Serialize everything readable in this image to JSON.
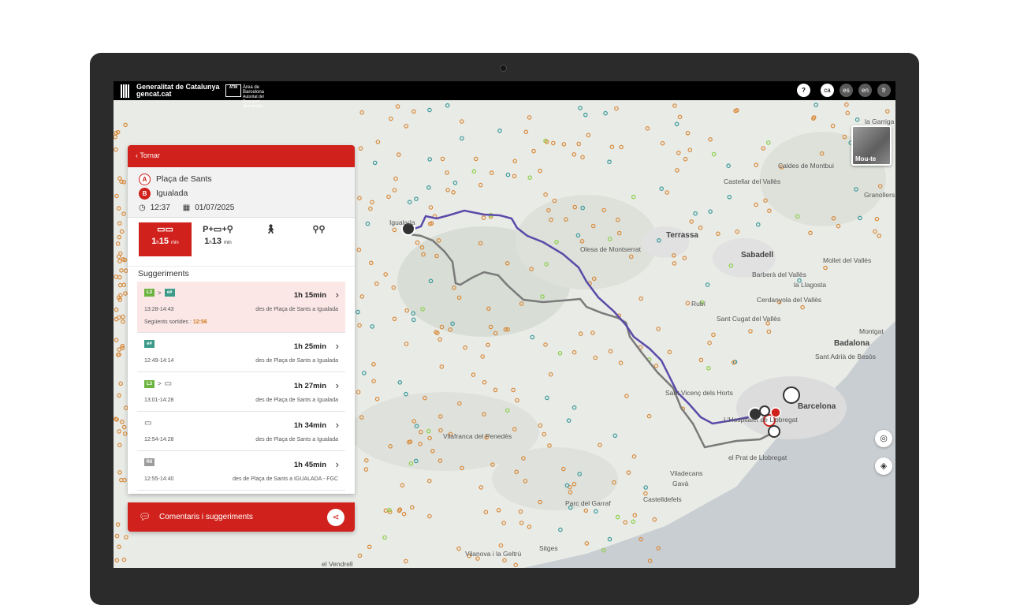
{
  "header": {
    "gencat_line1": "Generalitat de Catalunya",
    "gencat_line2": "gencat.cat",
    "atm_badge": "ATM",
    "atm_line1": "Àrea de Barcelona",
    "atm_line2": "Autoritat del Transport",
    "atm_line3": "Metropolità",
    "help": "?",
    "languages": [
      "ca",
      "es",
      "en",
      "fr"
    ],
    "active_language": "ca"
  },
  "panel": {
    "back_label": "Tornar",
    "origin_badge": "A",
    "origin": "Plaça de Sants",
    "destination_badge": "B",
    "destination": "Igualada",
    "time": "12:37",
    "date": "01/07/2025",
    "modes": [
      {
        "name": "bus",
        "icon": "bus-icon",
        "hours": "1",
        "h": "h",
        "minutes": "15",
        "min": "min",
        "active": true
      },
      {
        "name": "park-ride",
        "icon": "park-and-ride-icon",
        "hours": "1",
        "h": "h",
        "minutes": "13",
        "min": "min",
        "active": false
      },
      {
        "name": "walk",
        "icon": "walk-icon",
        "active": false
      },
      {
        "name": "bike",
        "icon": "bike-icon",
        "active": false
      }
    ],
    "suggestions_title": "Suggeriments",
    "suggestions": [
      {
        "chips": [
          {
            "label": "L3",
            "color": "#6cb33f"
          },
          {
            "label": "e#",
            "color": "#3c9a8a"
          }
        ],
        "duration": "1h 15min",
        "times": "13:28-14:43",
        "description": "des de Plaça de Sants a Igualada",
        "next_label": "Següents sortides :",
        "next_value": "12:56",
        "selected": true
      },
      {
        "chips": [
          {
            "label": "e#",
            "color": "#3c9a8a"
          }
        ],
        "duration": "1h 25min",
        "times": "12:49-14:14",
        "description": "des de Plaça de Sants a Igualada",
        "selected": false
      },
      {
        "chips": [
          {
            "label": "L3",
            "color": "#6cb33f"
          },
          {
            "label": "bus",
            "color": "bus"
          }
        ],
        "duration": "1h 27min",
        "times": "13:01-14:28",
        "description": "des de Plaça de Sants a Igualada",
        "selected": false
      },
      {
        "chips": [
          {
            "label": "bus",
            "color": "bus"
          }
        ],
        "duration": "1h 34min",
        "times": "12:54-14:28",
        "description": "des de Plaça de Sants a Igualada",
        "selected": false
      },
      {
        "chips": [
          {
            "label": "R6",
            "color": "#9b9b9b"
          }
        ],
        "duration": "1h 45min",
        "times": "12:55-14:40",
        "description": "des de Plaça de Sants a IGUALADA - FGC",
        "selected": false
      }
    ],
    "comments_label": "Comentaris i suggeriments"
  },
  "map": {
    "move_label": "Mou-te",
    "route_color": "#5b4aa8",
    "alt_route_color": "#7a7a7a",
    "places": [
      "la Garriga",
      "Caldes de Montbui",
      "Castellar del Vallès",
      "Granollers",
      "Terrassa",
      "Olesa de Montserrat",
      "Sabadell",
      "Mollet del Vallès",
      "Barberà del Vallès",
      "la Llagosta",
      "Cerdanyola del Vallès",
      "Rubí",
      "Sant Cugat del Vallès",
      "Montgat",
      "Badalona",
      "Sant Adrià de Besòs",
      "Barcelona",
      "Sant Vicenç dels Horts",
      "Vilafranca del Penedès",
      "L'Hospitalet de Llobregat",
      "el Prat de Llobregat",
      "Viladecans",
      "Gavà",
      "Castelldefels",
      "Parc del Garraf",
      "Sitges",
      "Vilanova i la Geltrú",
      "el Vendrell",
      "Igualada"
    ]
  }
}
